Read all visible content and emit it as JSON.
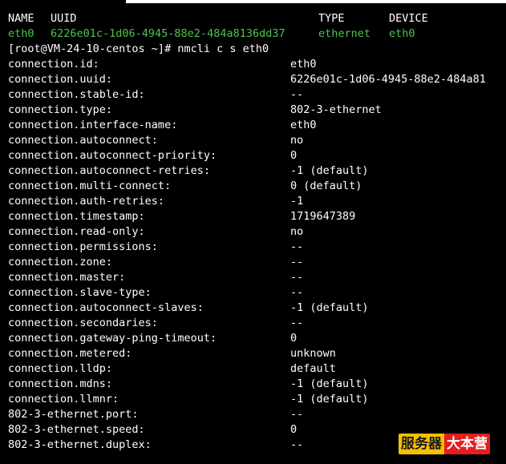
{
  "device_table": {
    "headers": {
      "name": "NAME",
      "uuid": "UUID",
      "type": "TYPE",
      "device": "DEVICE"
    },
    "row": {
      "name": "eth0",
      "uuid": "6226e01c-1d06-4945-88e2-484a8136dd37",
      "type": "ethernet",
      "device": "eth0"
    }
  },
  "prompt": "[root@VM-24-10-centos ~]# nmcli c s eth0",
  "properties": [
    {
      "key": "connection.id:",
      "value": "eth0"
    },
    {
      "key": "connection.uuid:",
      "value": "6226e01c-1d06-4945-88e2-484a81"
    },
    {
      "key": "connection.stable-id:",
      "value": "--"
    },
    {
      "key": "connection.type:",
      "value": "802-3-ethernet"
    },
    {
      "key": "connection.interface-name:",
      "value": "eth0"
    },
    {
      "key": "connection.autoconnect:",
      "value": "no"
    },
    {
      "key": "connection.autoconnect-priority:",
      "value": "0"
    },
    {
      "key": "connection.autoconnect-retries:",
      "value": "-1 (default)"
    },
    {
      "key": "connection.multi-connect:",
      "value": "0 (default)"
    },
    {
      "key": "connection.auth-retries:",
      "value": "-1"
    },
    {
      "key": "connection.timestamp:",
      "value": "1719647389"
    },
    {
      "key": "connection.read-only:",
      "value": "no"
    },
    {
      "key": "connection.permissions:",
      "value": "--"
    },
    {
      "key": "connection.zone:",
      "value": "--"
    },
    {
      "key": "connection.master:",
      "value": "--"
    },
    {
      "key": "connection.slave-type:",
      "value": "--"
    },
    {
      "key": "connection.autoconnect-slaves:",
      "value": "-1 (default)"
    },
    {
      "key": "connection.secondaries:",
      "value": "--"
    },
    {
      "key": "connection.gateway-ping-timeout:",
      "value": "0"
    },
    {
      "key": "connection.metered:",
      "value": "unknown"
    },
    {
      "key": "connection.lldp:",
      "value": "default"
    },
    {
      "key": "connection.mdns:",
      "value": "-1 (default)"
    },
    {
      "key": "connection.llmnr:",
      "value": "-1 (default)"
    },
    {
      "key": "802-3-ethernet.port:",
      "value": "--"
    },
    {
      "key": "802-3-ethernet.speed:",
      "value": "0"
    },
    {
      "key": "802-3-ethernet.duplex:",
      "value": "--"
    }
  ],
  "watermark": {
    "part1": "服务器",
    "part2": "大本营"
  },
  "colors": {
    "background": "#000000",
    "text": "#ffffff",
    "highlight": "#4ec24e",
    "watermark_yellow": "#f5c000",
    "watermark_red": "#e41e1e"
  }
}
